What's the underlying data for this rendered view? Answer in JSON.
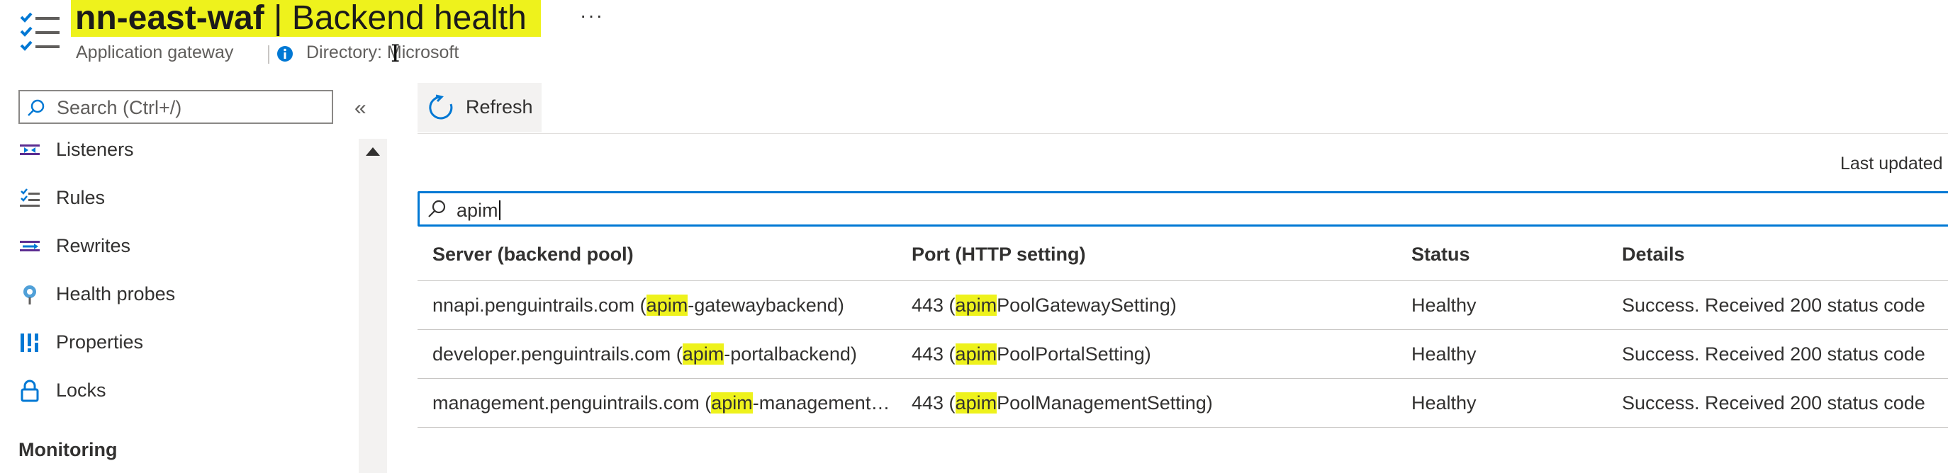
{
  "header": {
    "resource_name": "nn-east-waf",
    "separator": " | ",
    "page_name": "Backend health",
    "more_label": "···",
    "resource_type": "Application gateway",
    "directory": "Directory: Microsoft"
  },
  "sidebar": {
    "search_placeholder": "Search (Ctrl+/)",
    "collapse_label": "«",
    "items": [
      {
        "label": "Listeners",
        "icon": "listeners-icon"
      },
      {
        "label": "Rules",
        "icon": "rules-icon"
      },
      {
        "label": "Rewrites",
        "icon": "rewrites-icon"
      },
      {
        "label": "Health probes",
        "icon": "health-probe-icon"
      },
      {
        "label": "Properties",
        "icon": "properties-icon"
      },
      {
        "label": "Locks",
        "icon": "lock-icon"
      }
    ],
    "section_monitoring": "Monitoring"
  },
  "toolbar": {
    "refresh_label": "Refresh",
    "last_updated": "Last updated"
  },
  "filter": {
    "value": "apim"
  },
  "table": {
    "columns": [
      "Server (backend pool)",
      "Port (HTTP setting)",
      "Status",
      "Details"
    ],
    "rows": [
      {
        "server_pre": "nnapi.penguintrails.com (",
        "server_hl": "apim",
        "server_post": "-gatewaybackend)",
        "port_pre": "443 (",
        "port_hl": "apim",
        "port_post": "PoolGatewaySetting)",
        "status": "Healthy",
        "details": "Success. Received 200 status code"
      },
      {
        "server_pre": "developer.penguintrails.com (",
        "server_hl": "apim",
        "server_post": "-portalbackend)",
        "port_pre": "443 (",
        "port_hl": "apim",
        "port_post": "PoolPortalSetting)",
        "status": "Healthy",
        "details": "Success. Received 200 status code"
      },
      {
        "server_pre": "management.penguintrails.com (",
        "server_hl": "apim",
        "server_post": "-management…",
        "port_pre": "443 (",
        "port_hl": "apim",
        "port_post": "PoolManagementSetting)",
        "status": "Healthy",
        "details": "Success. Received 200 status code"
      }
    ]
  },
  "colors": {
    "highlight": "#eef21c",
    "accent": "#0078d4"
  }
}
